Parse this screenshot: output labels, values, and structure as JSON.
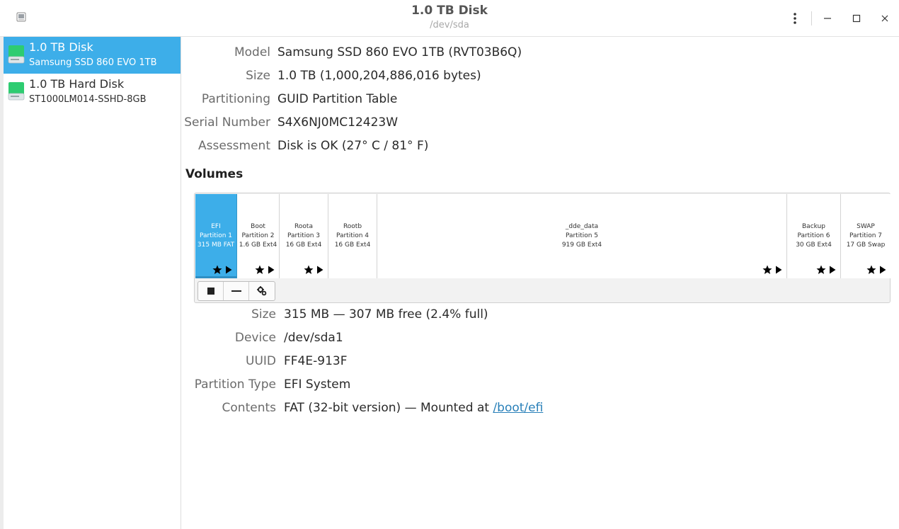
{
  "window": {
    "title": "1.0 TB Disk",
    "subtitle": "/dev/sda",
    "icons": {
      "app": "app-icon",
      "menu": "kebab-menu-icon",
      "minimize": "minimize-icon",
      "maximize": "maximize-icon",
      "close": "close-icon"
    }
  },
  "sidebar": {
    "items": [
      {
        "name": "1.0 TB Disk",
        "sub": "Samsung SSD 860 EVO 1TB",
        "selected": true
      },
      {
        "name": "1.0 TB Hard Disk",
        "sub": "ST1000LM014-SSHD-8GB",
        "selected": false
      }
    ]
  },
  "disk": {
    "model_label": "Model",
    "model": "Samsung SSD 860 EVO 1TB (RVT03B6Q)",
    "size_label": "Size",
    "size": "1.0 TB (1,000,204,886,016 bytes)",
    "partitioning_label": "Partitioning",
    "partitioning": "GUID Partition Table",
    "serial_label": "Serial Number",
    "serial": "S4X6NJ0MC12423W",
    "assessment_label": "Assessment",
    "assessment": "Disk is OK (27° C / 81° F)"
  },
  "volumes": {
    "title": "Volumes",
    "partitions": [
      {
        "name": "EFI",
        "num": "Partition 1",
        "size": "315 MB FAT",
        "selected": true,
        "icons": [
          "star-icon",
          "play-icon"
        ]
      },
      {
        "name": "Boot",
        "num": "Partition 2",
        "size": "1.6 GB Ext4",
        "selected": false,
        "icons": [
          "star-icon",
          "play-icon"
        ]
      },
      {
        "name": "Roota",
        "num": "Partition 3",
        "size": "16 GB Ext4",
        "selected": false,
        "icons": [
          "star-icon",
          "play-icon"
        ]
      },
      {
        "name": "Rootb",
        "num": "Partition 4",
        "size": "16 GB Ext4",
        "selected": false,
        "icons": []
      },
      {
        "name": "_dde_data",
        "num": "Partition 5",
        "size": "919 GB Ext4",
        "selected": false,
        "icons": [
          "star-icon",
          "play-icon"
        ]
      },
      {
        "name": "Backup",
        "num": "Partition 6",
        "size": "30 GB Ext4",
        "selected": false,
        "icons": [
          "star-icon",
          "play-icon"
        ]
      },
      {
        "name": "SWAP",
        "num": "Partition 7",
        "size": "17 GB Swap",
        "selected": false,
        "icons": [
          "star-icon",
          "play-icon"
        ]
      }
    ],
    "toolbar": [
      "stop-icon",
      "minus-icon",
      "gears-icon"
    ]
  },
  "partition": {
    "size_label": "Size",
    "size": "315 MB — 307 MB free (2.4% full)",
    "device_label": "Device",
    "device": "/dev/sda1",
    "uuid_label": "UUID",
    "uuid": "FF4E-913F",
    "type_label": "Partition Type",
    "type": "EFI System",
    "contents_label": "Contents",
    "contents_prefix": "FAT (32-bit version) — Mounted at ",
    "mount_link": "/boot/efi"
  },
  "colors": {
    "accent": "#3daee9",
    "link": "#2980b9"
  }
}
